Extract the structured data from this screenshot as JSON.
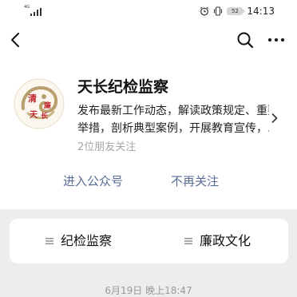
{
  "status_bar": {
    "network": "4G",
    "battery": "52",
    "time": "14:13"
  },
  "account": {
    "name": "天长纪检监察",
    "description_line1": "发布最新工作动态，解读政策规定、重要",
    "description_line2": "举措，剖析典型案例，开展教育宣传，...",
    "followers": "2位朋友关注",
    "avatar_text": "清 廉 天 长"
  },
  "actions": {
    "enter_label": "进入公众号",
    "unfollow_label": "不再关注"
  },
  "menu": {
    "items": [
      {
        "label": "纪检监察"
      },
      {
        "label": "廉政文化"
      }
    ]
  },
  "feed": {
    "date": "6月19日 晚上18:47"
  },
  "colors": {
    "link": "#576b95",
    "background": "#ededed",
    "avatar_accent": "#c0282d"
  },
  "icons": [
    "back-arrow-icon",
    "search-icon",
    "more-icon",
    "chevron-right-icon",
    "menu-lines-icon",
    "alarm-icon",
    "vibrate-icon"
  ]
}
